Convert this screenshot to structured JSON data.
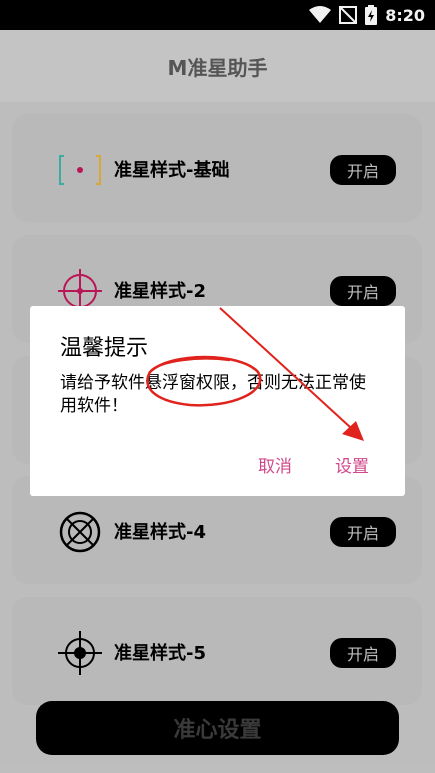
{
  "status_bar": {
    "time": "8:20",
    "icons": [
      "wifi-icon",
      "no-signal-icon",
      "battery-charging-icon"
    ]
  },
  "app_bar": {
    "title": "M准星助手"
  },
  "cards": [
    {
      "label": "准星样式-基础",
      "toggle": "开启",
      "icon": "crosshair-basic-icon"
    },
    {
      "label": "准星样式-2",
      "toggle": "开启",
      "icon": "crosshair-circle-icon"
    },
    {
      "label": "准星样式-4",
      "toggle": "开启",
      "icon": "crosshair-x-circle-icon"
    },
    {
      "label": "准星样式-5",
      "toggle": "开启",
      "icon": "crosshair-scope-icon"
    }
  ],
  "bottom_button": {
    "label": "准心设置"
  },
  "dialog": {
    "title": "温馨提示",
    "message": "请给予软件悬浮窗权限，否则无法正常使用软件！",
    "cancel_label": "取消",
    "ok_label": "设置"
  },
  "colors": {
    "dialog_button": "#d1488a",
    "annotation": "#e0231c",
    "crosshair": "#c2185b"
  }
}
